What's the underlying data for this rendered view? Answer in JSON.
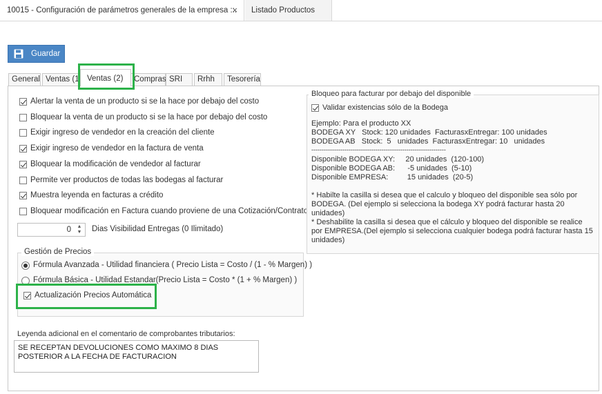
{
  "doc_tabs": {
    "active": "10015 - Configuración de parámetros generales de la empresa ::.",
    "close": "×",
    "inactive": "Listado Productos"
  },
  "toolbar": {
    "save_label": "Guardar"
  },
  "section_tabs": [
    "General",
    "Ventas (1",
    "Ventas (2)",
    "Compras",
    "SRI",
    "Rrhh",
    "Tesorería"
  ],
  "options": [
    {
      "label": "Alertar la venta de un producto si se la hace por debajo del costo",
      "checked": true
    },
    {
      "label": "Bloquear la venta de un producto si se la hace por debajo del costo",
      "checked": false
    },
    {
      "label": "Exigir ingreso de vendedor en la creación del cliente",
      "checked": false
    },
    {
      "label": "Exigir ingreso de vendedor en la factura de venta",
      "checked": true
    },
    {
      "label": "Bloquear la modificación de vendedor al facturar",
      "checked": true
    },
    {
      "label": "Permite ver productos de todas las bodegas al facturar",
      "checked": false
    },
    {
      "label": "Muestra leyenda en facturas a crédito",
      "checked": true
    },
    {
      "label": "Bloquear modificación en Factura cuando proviene de una Cotización/Contrato",
      "checked": false
    }
  ],
  "visibility": {
    "value": "0",
    "label": "Dias Visibilidad Entregas (0 Ilimitado)"
  },
  "pricing": {
    "title": "Gestión de Precios",
    "radio1": "Fórmula Avanzada - Utilidad financiera ( Precio Lista = Costo / (1 - % Margen) )",
    "radio2": "Fórmula Básica - Utilidad Estandar(Precio Lista = Costo * (1 + % Margen) )",
    "auto_update": "Actualización Precios Automática",
    "auto_update_checked": true
  },
  "legend": {
    "label": "Leyenda adicional en el comentario de comprobantes tributarios:",
    "value": "SE RECEPTAN DEVOLUCIONES COMO MAXIMO 8 DIAS POSTERIOR A LA FECHA DE FACTURACION"
  },
  "block": {
    "title": "Bloqueo para facturar por debajo del disponible",
    "validate": "Validar existencias sólo de la Bodega",
    "validate_checked": true,
    "example_lines": [
      "Ejemplo: Para el producto XX",
      "BODEGA XY   Stock: 120 unidades  FacturasxEntregar: 100 unidades",
      "BODEGA AB   Stock:  5   unidades  FacturasxEntregar: 10   unidades",
      "-----------------------------------------------------------------",
      "Disponible BODEGA XY:     20 unidades  (120-100)",
      "Disponible BODEGA AB:      -5 unidades  (5-10)",
      "Disponible EMPRESA:         15 unidades  (20-5)"
    ],
    "note1": "* Habilte la casilla si desea que el calculo y bloqueo del disponible sea sólo por BODEGA. (Del ejemplo si selecciona la bodega XY podrá facturar hasta 20 unidades)",
    "note2": "* Deshabilite la casilla si desea que el cálculo y bloqueo del disponible se realice por EMPRESA.(Del ejemplo si selecciona cualquier bodega podrá facturar hasta 15 unidades)"
  },
  "colors": {
    "accent": "#4a86c5",
    "highlight": "#2db24a"
  }
}
